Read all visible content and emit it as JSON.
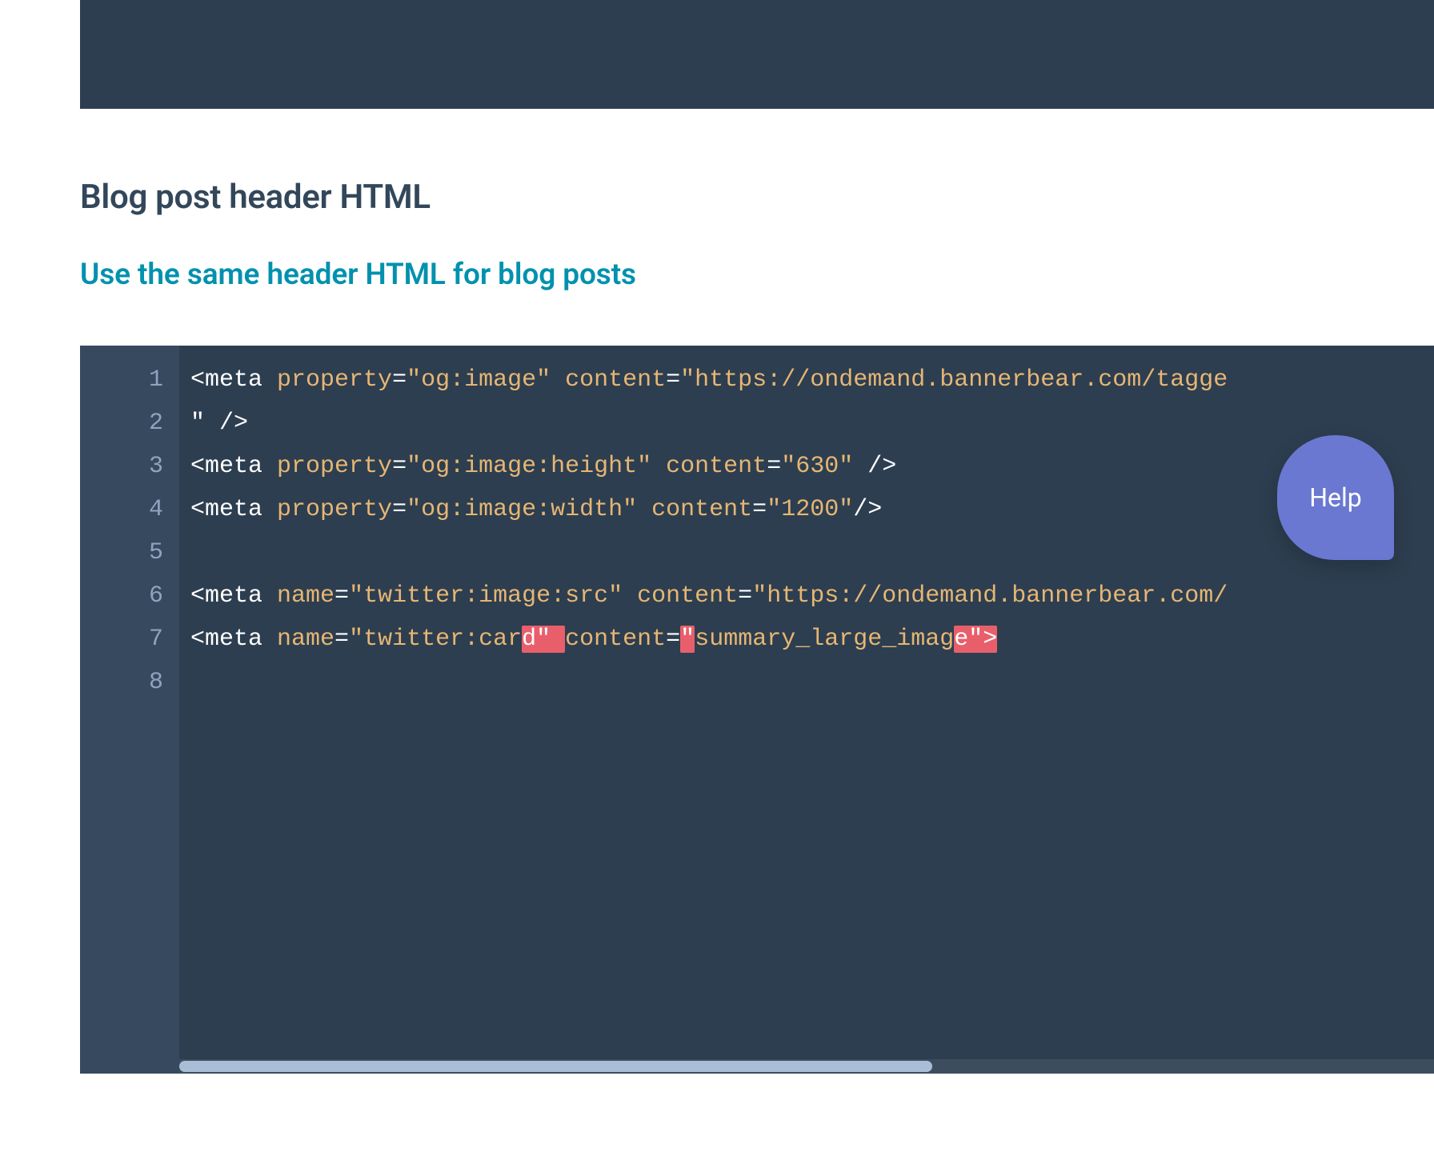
{
  "headings": {
    "section_title": "Blog post header HTML",
    "subsection_link": "Use the same header HTML for blog posts"
  },
  "editor": {
    "line_numbers": [
      "1",
      "2",
      "3",
      "4",
      "5",
      "6",
      "7",
      "8"
    ],
    "lines": {
      "l1": {
        "open": "<meta ",
        "attr1": "property",
        "eq1": "=",
        "val1": "\"og:image\"",
        "sp1": "  ",
        "attr2": "content",
        "eq2": "=",
        "val2_open": "\"https://ondemand.bannerbear.com/tagge"
      },
      "l2": {
        "text": "\" />"
      },
      "l3": {
        "open": "<meta ",
        "attr1": "property",
        "eq1": "=",
        "val1": "\"og:image:height\"",
        "sp1": "  ",
        "attr2": "content",
        "eq2": "=",
        "val2": "\"630\"",
        "close": " />"
      },
      "l4": {
        "open": "<meta ",
        "attr1": "property",
        "eq1": "=",
        "val1": "\"og:image:width\"",
        "sp1": " ",
        "attr2": "content",
        "eq2": "=",
        "val2": "\"1200\"",
        "close": "/>"
      },
      "l5": {
        "text": ""
      },
      "l6": {
        "open": "<meta ",
        "attr1": "name",
        "eq1": "=",
        "val1": "\"twitter:image:src\"",
        "sp1": "  ",
        "attr2": "content",
        "eq2": "=",
        "val2_open": "\"https://ondemand.bannerbear.com/"
      },
      "l7": {
        "open": "<meta ",
        "attr1": "name",
        "eq1": "=",
        "val1_pre": "\"twitter:car",
        "hl1": "d\"  ",
        "attr2": "content",
        "eq2": "=",
        "hl2a": "\"",
        "val2_mid": "summary_large_imag",
        "hl2b": "e\">"
      },
      "l8": {
        "text": ""
      }
    }
  },
  "help": {
    "label": "Help"
  }
}
